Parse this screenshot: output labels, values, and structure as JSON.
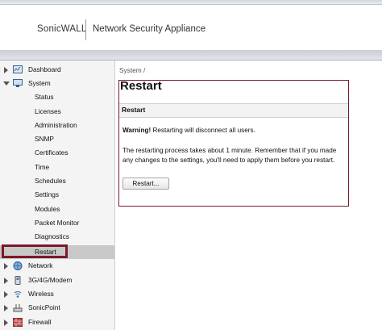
{
  "header": {
    "brand": "SonicWALL",
    "product": "Network Security Appliance"
  },
  "sidebar": {
    "items": [
      {
        "label": "Dashboard",
        "icon": "dashboard-icon",
        "expanded": false
      },
      {
        "label": "System",
        "icon": "system-icon",
        "expanded": true
      },
      {
        "label": "Network",
        "icon": "network-icon",
        "expanded": false
      },
      {
        "label": "3G/4G/Modem",
        "icon": "modem-icon",
        "expanded": false
      },
      {
        "label": "Wireless",
        "icon": "wireless-icon",
        "expanded": false
      },
      {
        "label": "SonicPoint",
        "icon": "sonicpoint-icon",
        "expanded": false
      },
      {
        "label": "Firewall",
        "icon": "firewall-icon",
        "expanded": false
      }
    ],
    "system_children": [
      "Status",
      "Licenses",
      "Administration",
      "SNMP",
      "Certificates",
      "Time",
      "Schedules",
      "Settings",
      "Modules",
      "Packet Monitor",
      "Diagnostics",
      "Restart"
    ],
    "selected": "Restart"
  },
  "main": {
    "breadcrumb": "System /",
    "title": "Restart",
    "section_title": "Restart",
    "warning_label": "Warning!",
    "warning_text": " Restarting will disconnect all users.",
    "note": "The restarting process takes about 1 minute. Remember that if you made any changes to the settings, you'll need to apply them before you restart.",
    "button_label": "Restart..."
  },
  "colors": {
    "highlight": "#7a1a2a",
    "selected_bg": "#c8c8c8"
  }
}
